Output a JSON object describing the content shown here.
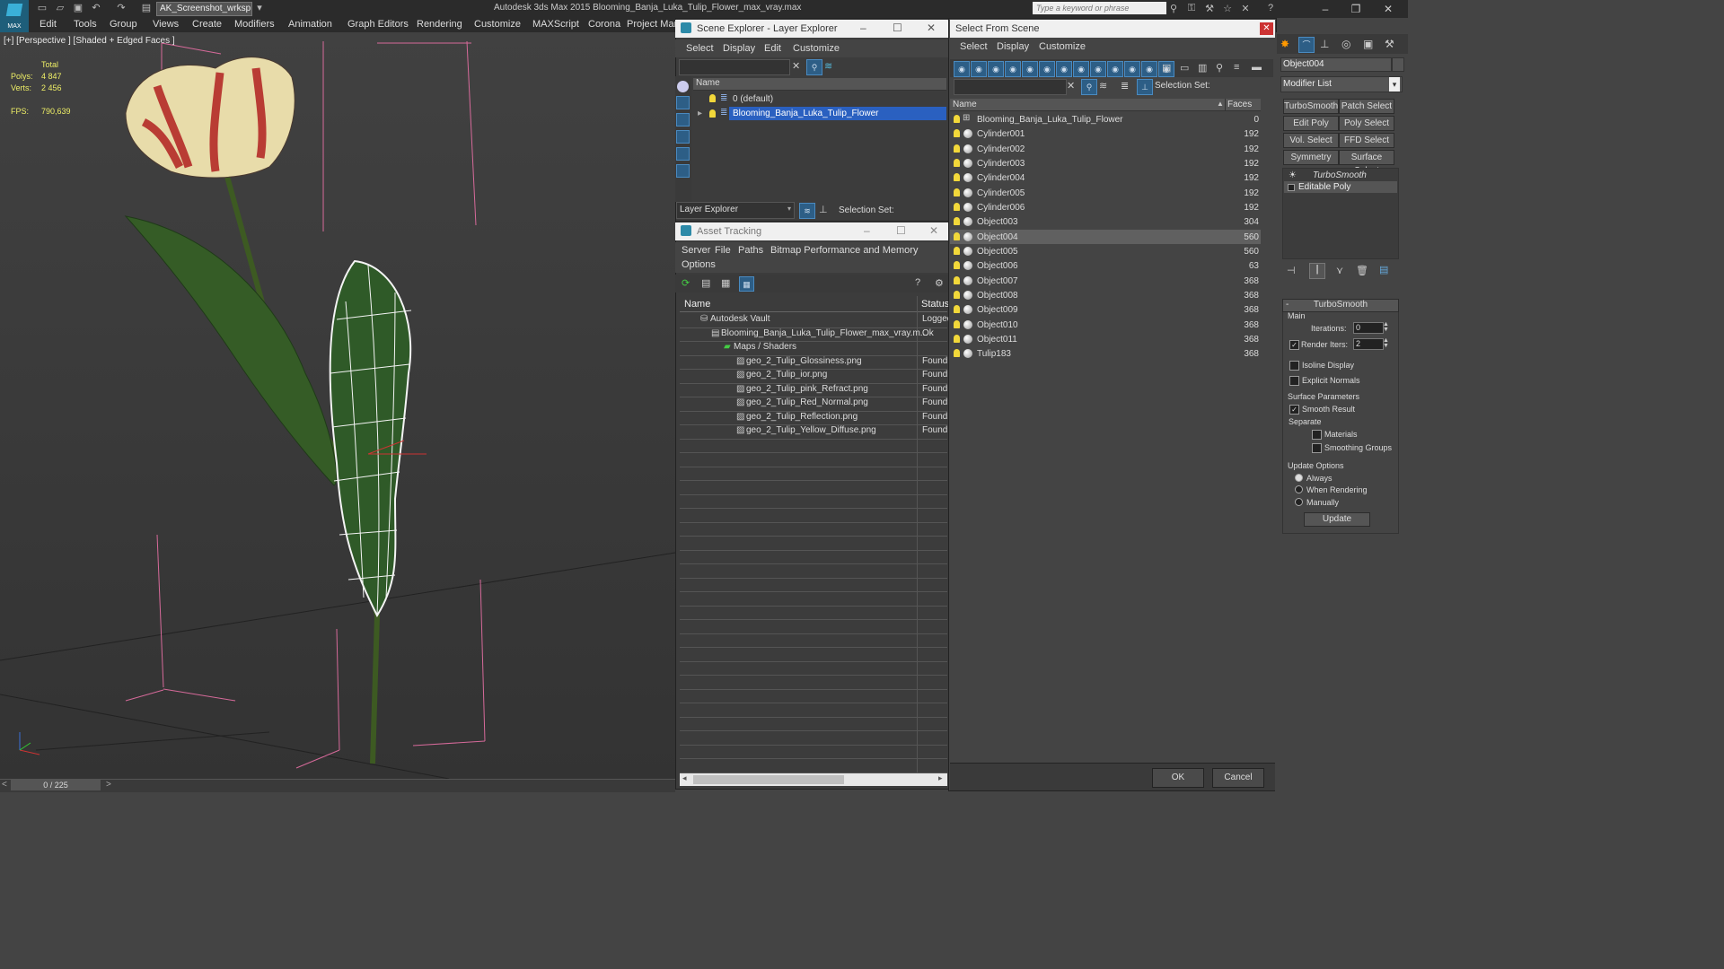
{
  "app": {
    "logo_label": "MAX",
    "workspace": "AK_Screenshot_wrksp",
    "title": "Autodesk 3ds Max  2015     Blooming_Banja_Luka_Tulip_Flower_max_vray.max",
    "search_placeholder": "Type a keyword or phrase"
  },
  "menu": [
    "Edit",
    "Tools",
    "Group",
    "Views",
    "Create",
    "Modifiers",
    "Animation",
    "Graph Editors",
    "Rendering",
    "Customize",
    "MAXScript",
    "Corona",
    "Project Man"
  ],
  "viewport": {
    "label": "[+] [Perspective ] [Shaded + Edged Faces ]",
    "stats": {
      "total_label": "Total",
      "polys_label": "Polys:",
      "polys": "4 847",
      "verts_label": "Verts:",
      "verts": "2 456",
      "fps_label": "FPS:",
      "fps": "790,639"
    },
    "timeline": "0 / 225"
  },
  "scene_explorer": {
    "title": "Scene Explorer - Layer Explorer",
    "menu": [
      "Select",
      "Display",
      "Edit",
      "Customize"
    ],
    "col_name": "Name",
    "layers": [
      "0 (default)",
      "Blooming_Banja_Luka_Tulip_Flower"
    ],
    "footer_mode": "Layer Explorer",
    "selection_set": "Selection Set:"
  },
  "asset_tracking": {
    "title": "Asset Tracking",
    "menu": [
      "Server",
      "File",
      "Paths",
      "Bitmap Performance and Memory",
      "Options"
    ],
    "col_name": "Name",
    "col_status": "Status",
    "rows": [
      {
        "name": "Autodesk Vault",
        "status": "Logged",
        "indent": 1
      },
      {
        "name": "Blooming_Banja_Luka_Tulip_Flower_max_vray.m...",
        "status": "Ok",
        "indent": 2
      },
      {
        "name": "Maps / Shaders",
        "status": "",
        "indent": 3
      },
      {
        "name": "geo_2_Tulip_Glossiness.png",
        "status": "Found",
        "indent": 4
      },
      {
        "name": "geo_2_Tulip_ior.png",
        "status": "Found",
        "indent": 4
      },
      {
        "name": "geo_2_Tulip_pink_Refract.png",
        "status": "Found",
        "indent": 4
      },
      {
        "name": "geo_2_Tulip_Red_Normal.png",
        "status": "Found",
        "indent": 4
      },
      {
        "name": "geo_2_Tulip_Reflection.png",
        "status": "Found",
        "indent": 4
      },
      {
        "name": "geo_2_Tulip_Yellow_Diffuse.png",
        "status": "Found",
        "indent": 4
      }
    ]
  },
  "select_from_scene": {
    "title": "Select From Scene",
    "menu": [
      "Select",
      "Display",
      "Customize"
    ],
    "selection_set": "Selection Set:",
    "col_name": "Name",
    "col_faces": "Faces",
    "rows": [
      {
        "name": "Blooming_Banja_Luka_Tulip_Flower",
        "faces": "0",
        "selected": false,
        "group": true
      },
      {
        "name": "Cylinder001",
        "faces": "192",
        "selected": false
      },
      {
        "name": "Cylinder002",
        "faces": "192",
        "selected": false
      },
      {
        "name": "Cylinder003",
        "faces": "192",
        "selected": false
      },
      {
        "name": "Cylinder004",
        "faces": "192",
        "selected": false
      },
      {
        "name": "Cylinder005",
        "faces": "192",
        "selected": false
      },
      {
        "name": "Cylinder006",
        "faces": "192",
        "selected": false
      },
      {
        "name": "Object003",
        "faces": "304",
        "selected": false
      },
      {
        "name": "Object004",
        "faces": "560",
        "selected": true
      },
      {
        "name": "Object005",
        "faces": "560",
        "selected": false
      },
      {
        "name": "Object006",
        "faces": "63",
        "selected": false
      },
      {
        "name": "Object007",
        "faces": "368",
        "selected": false
      },
      {
        "name": "Object008",
        "faces": "368",
        "selected": false
      },
      {
        "name": "Object009",
        "faces": "368",
        "selected": false
      },
      {
        "name": "Object010",
        "faces": "368",
        "selected": false
      },
      {
        "name": "Object011",
        "faces": "368",
        "selected": false
      },
      {
        "name": "Tulip183",
        "faces": "368",
        "selected": false
      }
    ],
    "ok": "OK",
    "cancel": "Cancel"
  },
  "modify_panel": {
    "object_name": "Object004",
    "modifier_list": "Modifier List",
    "buttons": [
      "TurboSmooth",
      "Patch Select",
      "Edit Poly",
      "Poly Select",
      "Vol. Select",
      "FFD Select",
      "Symmetry",
      "Surface Select"
    ],
    "stack": [
      "TurboSmooth",
      "Editable Poly"
    ],
    "rollout_title": "TurboSmooth",
    "main_label": "Main",
    "iterations_label": "Iterations:",
    "iterations": "0",
    "render_iters_label": "Render Iters:",
    "render_iters": "2",
    "isoline": "Isoline Display",
    "explicit_normals": "Explicit Normals",
    "surface_params": "Surface Parameters",
    "smooth_result": "Smooth Result",
    "separate": "Separate",
    "materials": "Materials",
    "smoothing_groups": "Smoothing Groups",
    "update_options": "Update Options",
    "always": "Always",
    "when_rendering": "When Rendering",
    "manually": "Manually",
    "update": "Update"
  }
}
